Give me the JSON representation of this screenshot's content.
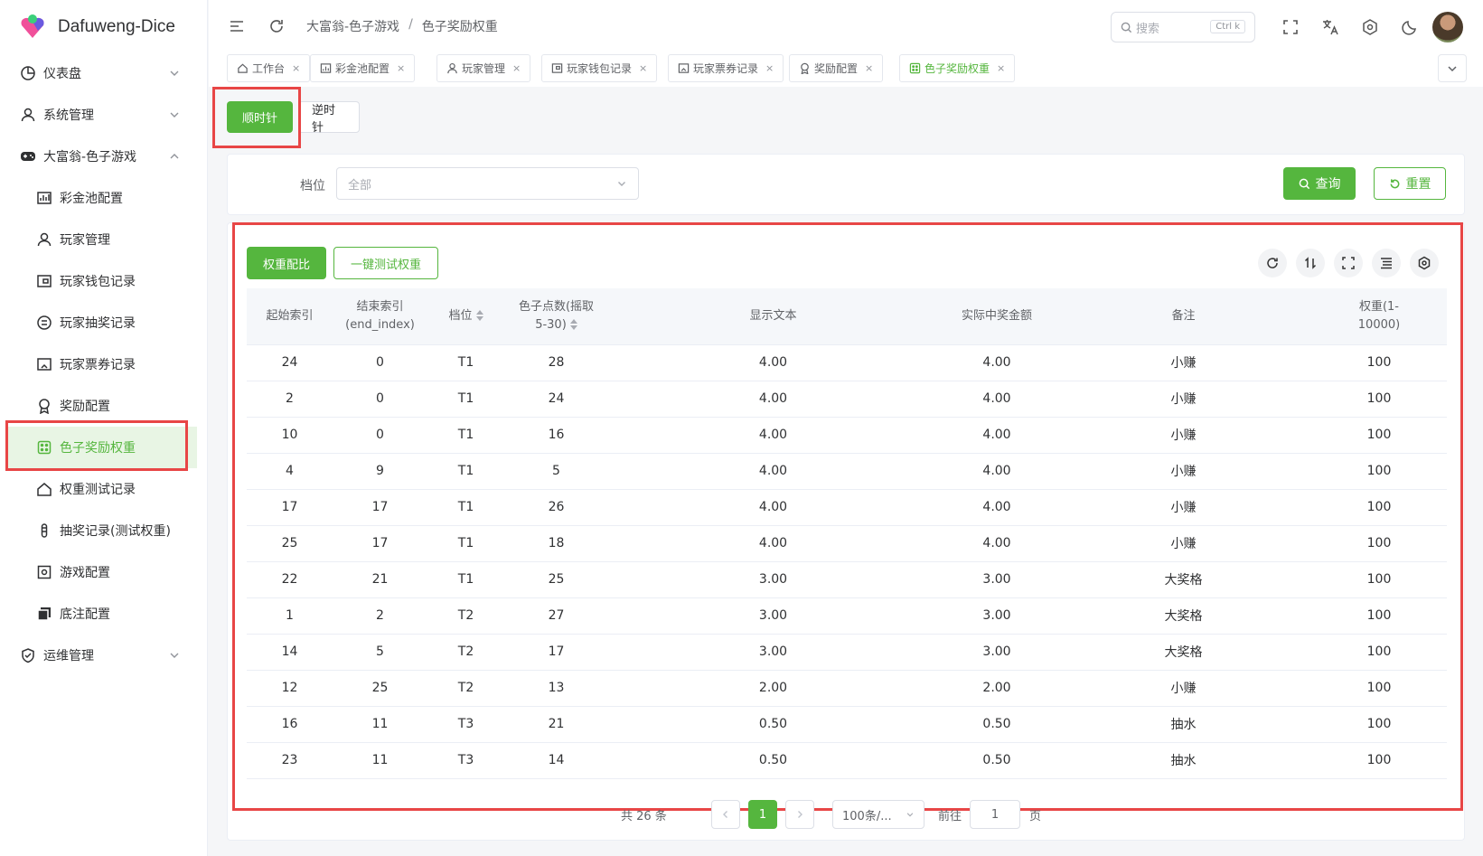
{
  "app": {
    "name": "Dafuweng-Dice"
  },
  "sidebar": {
    "items": [
      {
        "label": "仪表盘",
        "icon": "dashboard-icon"
      },
      {
        "label": "系统管理",
        "icon": "user-icon"
      },
      {
        "label": "大富翁-色子游戏",
        "icon": "gamepad-icon"
      },
      {
        "label": "彩金池配置",
        "icon": "chart-icon"
      },
      {
        "label": "玩家管理",
        "icon": "user-icon"
      },
      {
        "label": "玩家钱包记录",
        "icon": "wallet-icon"
      },
      {
        "label": "玩家抽奖记录",
        "icon": "record-icon"
      },
      {
        "label": "玩家票券记录",
        "icon": "ticket-icon"
      },
      {
        "label": "奖励配置",
        "icon": "award-icon"
      },
      {
        "label": "色子奖励权重",
        "icon": "dice-icon"
      },
      {
        "label": "权重测试记录",
        "icon": "home-icon"
      },
      {
        "label": "抽奖记录(测试权重)",
        "icon": "tube-icon"
      },
      {
        "label": "游戏配置",
        "icon": "gear-box-icon"
      },
      {
        "label": "底注配置",
        "icon": "copy-icon"
      },
      {
        "label": "运维管理",
        "icon": "shield-icon"
      }
    ]
  },
  "header": {
    "breadcrumb": [
      "大富翁-色子游戏",
      "色子奖励权重"
    ],
    "breadcrumb_sep": "/",
    "search_placeholder": "搜索",
    "search_kbd": "Ctrl k"
  },
  "tabs": [
    {
      "label": "工作台",
      "icon": "home-icon"
    },
    {
      "label": "彩金池配置",
      "icon": "chart-icon"
    },
    {
      "label": "玩家管理",
      "icon": "user-icon"
    },
    {
      "label": "玩家钱包记录",
      "icon": "wallet-icon"
    },
    {
      "label": "玩家票券记录",
      "icon": "ticket-icon"
    },
    {
      "label": "奖励配置",
      "icon": "award-icon"
    },
    {
      "label": "色子奖励权重",
      "icon": "dice-icon"
    }
  ],
  "tab_close": "×",
  "direction": {
    "clockwise": "顺时针",
    "counterclockwise": "逆时针"
  },
  "filter": {
    "label": "档位",
    "placeholder": "全部",
    "query": "查询",
    "reset": "重置"
  },
  "toolbar": {
    "ratio": "权重配比",
    "test": "一键测试权重"
  },
  "table": {
    "headers": [
      "起始索引",
      "结束索引\n(end_index)",
      "档位",
      "色子点数(摇取\n5-30)",
      "显示文本",
      "实际中奖金额",
      "备注",
      "权重(1-\n10000)"
    ],
    "rows": [
      [
        "24",
        "0",
        "T1",
        "28",
        "4.00",
        "4.00",
        "小赚",
        "100"
      ],
      [
        "2",
        "0",
        "T1",
        "24",
        "4.00",
        "4.00",
        "小赚",
        "100"
      ],
      [
        "10",
        "0",
        "T1",
        "16",
        "4.00",
        "4.00",
        "小赚",
        "100"
      ],
      [
        "4",
        "9",
        "T1",
        "5",
        "4.00",
        "4.00",
        "小赚",
        "100"
      ],
      [
        "17",
        "17",
        "T1",
        "26",
        "4.00",
        "4.00",
        "小赚",
        "100"
      ],
      [
        "25",
        "17",
        "T1",
        "18",
        "4.00",
        "4.00",
        "小赚",
        "100"
      ],
      [
        "22",
        "21",
        "T1",
        "25",
        "3.00",
        "3.00",
        "大奖格",
        "100"
      ],
      [
        "1",
        "2",
        "T2",
        "27",
        "3.00",
        "3.00",
        "大奖格",
        "100"
      ],
      [
        "14",
        "5",
        "T2",
        "17",
        "3.00",
        "3.00",
        "大奖格",
        "100"
      ],
      [
        "12",
        "25",
        "T2",
        "13",
        "2.00",
        "2.00",
        "小赚",
        "100"
      ],
      [
        "16",
        "11",
        "T3",
        "21",
        "0.50",
        "0.50",
        "抽水",
        "100"
      ],
      [
        "23",
        "11",
        "T3",
        "14",
        "0.50",
        "0.50",
        "抽水",
        "100"
      ]
    ]
  },
  "pagination": {
    "total": "共 26 条",
    "current_page": "1",
    "page_size": "100条/...",
    "goto_label": "前往",
    "goto_value": "1",
    "page_suffix": "页"
  },
  "colors": {
    "accent": "#55b63e",
    "highlight": "#e84646"
  }
}
